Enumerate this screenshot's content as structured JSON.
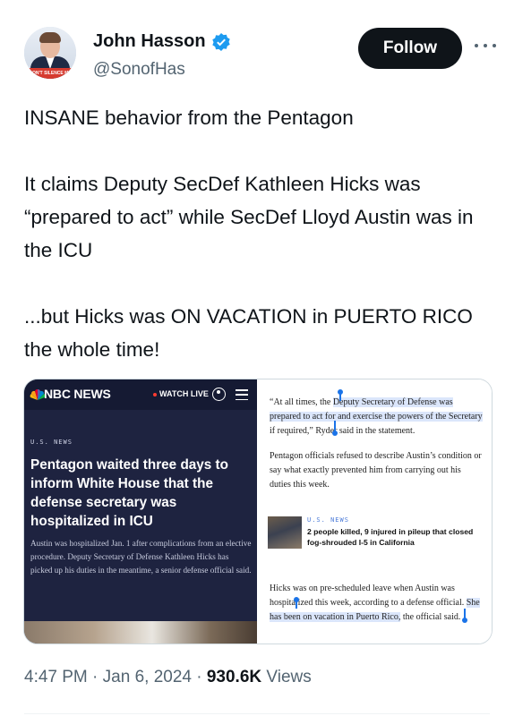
{
  "author": {
    "name": "John Hasson",
    "handle": "@SonofHas",
    "avatar_caption": "DON'T SILENCE ME",
    "verified_icon": "verified-badge-icon",
    "verified_color": "#1d9bf0"
  },
  "follow_label": "Follow",
  "tweet_text": "INSANE behavior from the Pentagon\n\nIt claims Deputy SecDef Kathleen Hicks was “prepared to act” while SecDef Lloyd Austin was in the ICU\n\n...but Hicks was ON VACATION in PUERTO RICO the whole time!",
  "media": {
    "left": {
      "logo": "NBC NEWS",
      "watch_live": "WATCH LIVE",
      "section": "U.S. NEWS",
      "headline": "Pentagon waited three days to inform White House that the defense secretary was hospitalized in ICU",
      "dek": "Austin was hospitalized Jan. 1 after complications from an elective procedure. Deputy Secretary of Defense Kathleen Hicks has picked up his duties in the meantime, a senior defense official said."
    },
    "right": {
      "para1_pre": "“At all times, the ",
      "para1_hl": "Deputy Secretary of Defense was prepared to act for and exercise the powers of the Secretary",
      "para1_post": " if required,” Ryder said in the statement.",
      "para2": "Pentagon officials refused to describe Austin’s condition or say what exactly prevented him from carrying out his duties this week.",
      "related_kicker": "U.S. NEWS",
      "related_title": "2 people killed, 9 injured in pileup that closed fog-shrouded I-5 in California",
      "para3_pre": "Hicks was on pre-scheduled leave when Austin was hospitalized this week, according to a defense official. ",
      "para3_hl": "She has been on vacation in Puerto Rico,",
      "para3_post": " the official said."
    }
  },
  "meta": {
    "time": "4:47 PM",
    "sep1": " · ",
    "date": "Jan 6, 2024",
    "sep2": " · ",
    "views": "930.6K",
    "views_label": " Views"
  }
}
